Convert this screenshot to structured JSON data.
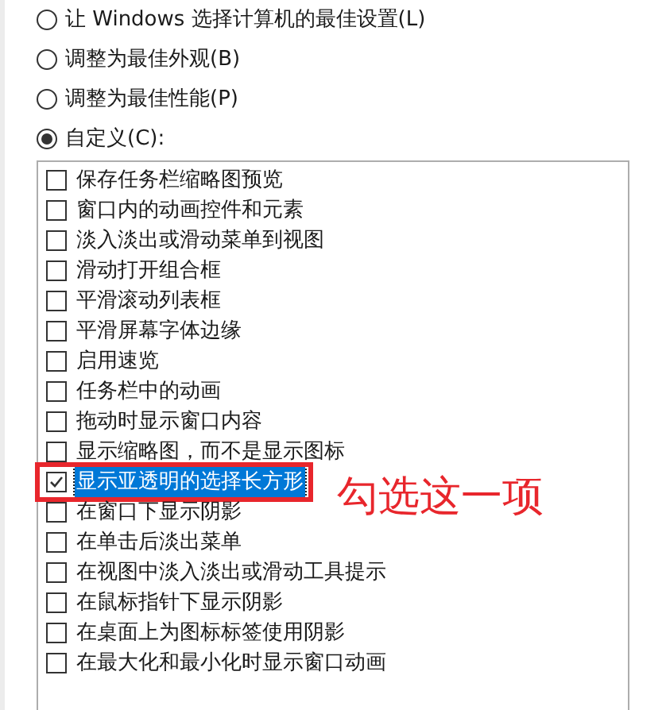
{
  "radio_options": [
    {
      "label": "让 Windows 选择计算机的最佳设置(L)",
      "selected": false
    },
    {
      "label": "调整为最佳外观(B)",
      "selected": false
    },
    {
      "label": "调整为最佳性能(P)",
      "selected": false
    },
    {
      "label": "自定义(C):",
      "selected": true
    }
  ],
  "effects": [
    {
      "label": "保存任务栏缩略图预览",
      "checked": false,
      "selected": false,
      "annotated": false
    },
    {
      "label": "窗口内的动画控件和元素",
      "checked": false,
      "selected": false,
      "annotated": false
    },
    {
      "label": "淡入淡出或滑动菜单到视图",
      "checked": false,
      "selected": false,
      "annotated": false
    },
    {
      "label": "滑动打开组合框",
      "checked": false,
      "selected": false,
      "annotated": false
    },
    {
      "label": "平滑滚动列表框",
      "checked": false,
      "selected": false,
      "annotated": false
    },
    {
      "label": "平滑屏幕字体边缘",
      "checked": false,
      "selected": false,
      "annotated": false
    },
    {
      "label": "启用速览",
      "checked": false,
      "selected": false,
      "annotated": false
    },
    {
      "label": "任务栏中的动画",
      "checked": false,
      "selected": false,
      "annotated": false
    },
    {
      "label": "拖动时显示窗口内容",
      "checked": false,
      "selected": false,
      "annotated": false
    },
    {
      "label": "显示缩略图，而不是显示图标",
      "checked": false,
      "selected": false,
      "annotated": false
    },
    {
      "label": "显示亚透明的选择长方形",
      "checked": true,
      "selected": true,
      "annotated": true
    },
    {
      "label": "在窗口下显示阴影",
      "checked": false,
      "selected": false,
      "annotated": false
    },
    {
      "label": "在单击后淡出菜单",
      "checked": false,
      "selected": false,
      "annotated": false
    },
    {
      "label": "在视图中淡入淡出或滑动工具提示",
      "checked": false,
      "selected": false,
      "annotated": false
    },
    {
      "label": "在鼠标指针下显示阴影",
      "checked": false,
      "selected": false,
      "annotated": false
    },
    {
      "label": "在桌面上为图标标签使用阴影",
      "checked": false,
      "selected": false,
      "annotated": false
    },
    {
      "label": "在最大化和最小化时显示窗口动画",
      "checked": false,
      "selected": false,
      "annotated": false
    }
  ],
  "annotation": {
    "text": "勾选这一项"
  }
}
